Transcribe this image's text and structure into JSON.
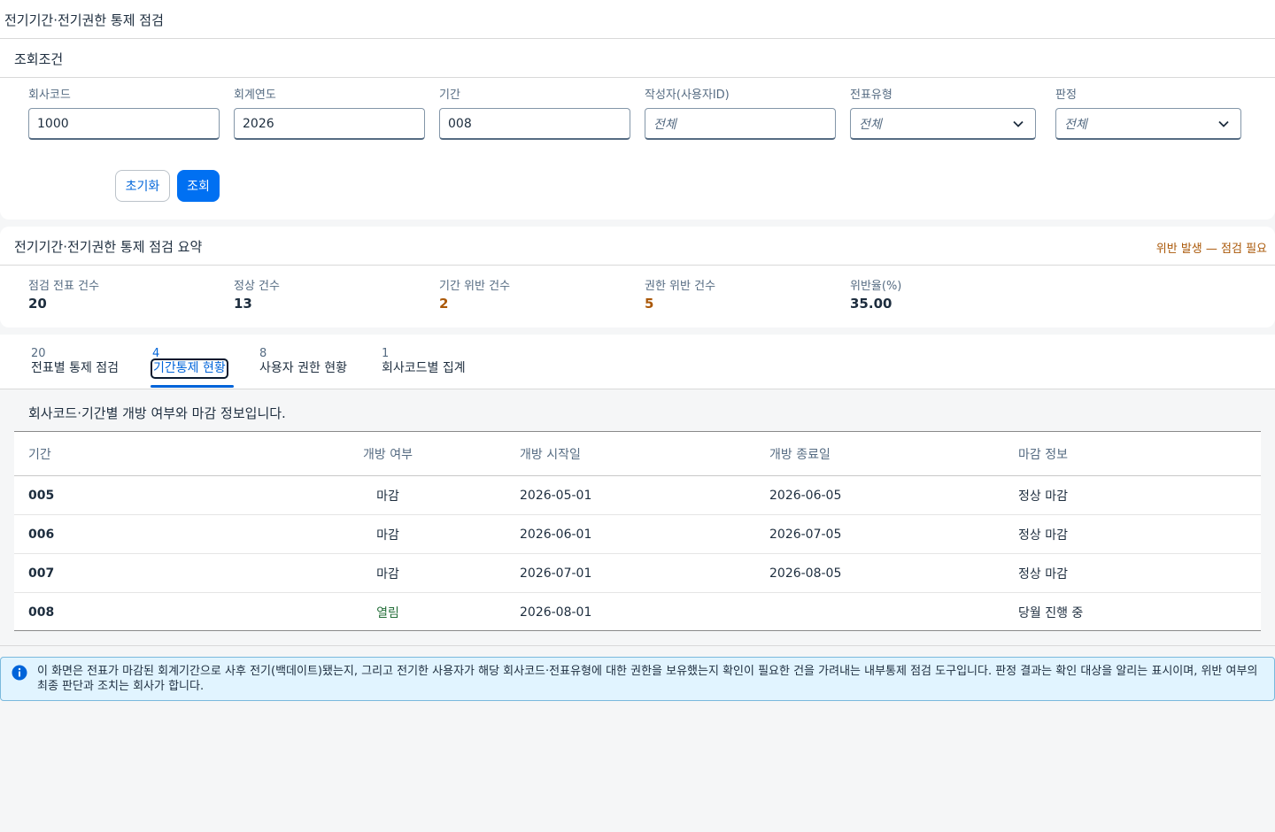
{
  "header": {
    "title": "전기기간·전기권한 통제 점검"
  },
  "filter": {
    "title": "조회조건",
    "fields": [
      {
        "label": "회사코드",
        "value": "1000",
        "placeholder": ""
      },
      {
        "label": "회계연도",
        "value": "2026",
        "placeholder": ""
      },
      {
        "label": "기간",
        "value": "008",
        "placeholder": ""
      },
      {
        "label": "작성자(사용자ID)",
        "value": "",
        "placeholder": "전체"
      },
      {
        "label": "전표유형",
        "value": "전체",
        "type": "select"
      },
      {
        "label": "판정",
        "value": "전체",
        "type": "select"
      }
    ],
    "reset_label": "초기화",
    "search_label": "조회"
  },
  "summary": {
    "title": "전기기간·전기권한 통제 점검 요약",
    "status": "위반 발생 — 점검 필요",
    "kpis": [
      {
        "label": "점검 전표 건수",
        "value": "20"
      },
      {
        "label": "정상 건수",
        "value": "13"
      },
      {
        "label": "기간 위반 건수",
        "value": "2"
      },
      {
        "label": "권한 위반 건수",
        "value": "5"
      },
      {
        "label": "위반율(%)",
        "value": "35.00"
      }
    ]
  },
  "tabs": [
    {
      "count": "20",
      "label": "전표별 통제 점검"
    },
    {
      "count": "4",
      "label": "기간통제 현황",
      "active": true
    },
    {
      "count": "8",
      "label": "사용자 권한 현황"
    },
    {
      "count": "1",
      "label": "회사코드별 집계"
    }
  ],
  "period_table": {
    "description": "회사코드·기간별 개방 여부와 마감 정보입니다.",
    "columns": [
      "기간",
      "개방 여부",
      "개방 시작일",
      "개방 종료일",
      "마감 정보"
    ],
    "rows": [
      {
        "period": "005",
        "open": "마감",
        "start": "2026-05-01",
        "end": "2026-06-05",
        "close_info": "정상 마감"
      },
      {
        "period": "006",
        "open": "마감",
        "start": "2026-06-01",
        "end": "2026-07-05",
        "close_info": "정상 마감"
      },
      {
        "period": "007",
        "open": "마감",
        "start": "2026-07-01",
        "end": "2026-08-05",
        "close_info": "정상 마감"
      },
      {
        "period": "008",
        "open": "열림",
        "start": "2026-08-01",
        "end": "",
        "close_info": "당월 진행 중"
      }
    ]
  },
  "info": {
    "icon": "info-icon",
    "text": "이 화면은 전표가 마감된 회계기간으로 사후 전기(백데이트)됐는지, 그리고 전기한 사용자가 해당 회사코드·전표유형에 대한 권한을 보유했는지 확인이 필요한 건을 가려내는 내부통제 점검 도구입니다. 판정 결과는 확인 대상을 알리는 표시이며, 위반 여부의 최종 판단과 조치는 회사가 합니다."
  },
  "colors": {
    "accent": "#0070f2",
    "warning": "#aa5808",
    "positive": "#256f3a",
    "info_bg": "#e1f4ff"
  }
}
